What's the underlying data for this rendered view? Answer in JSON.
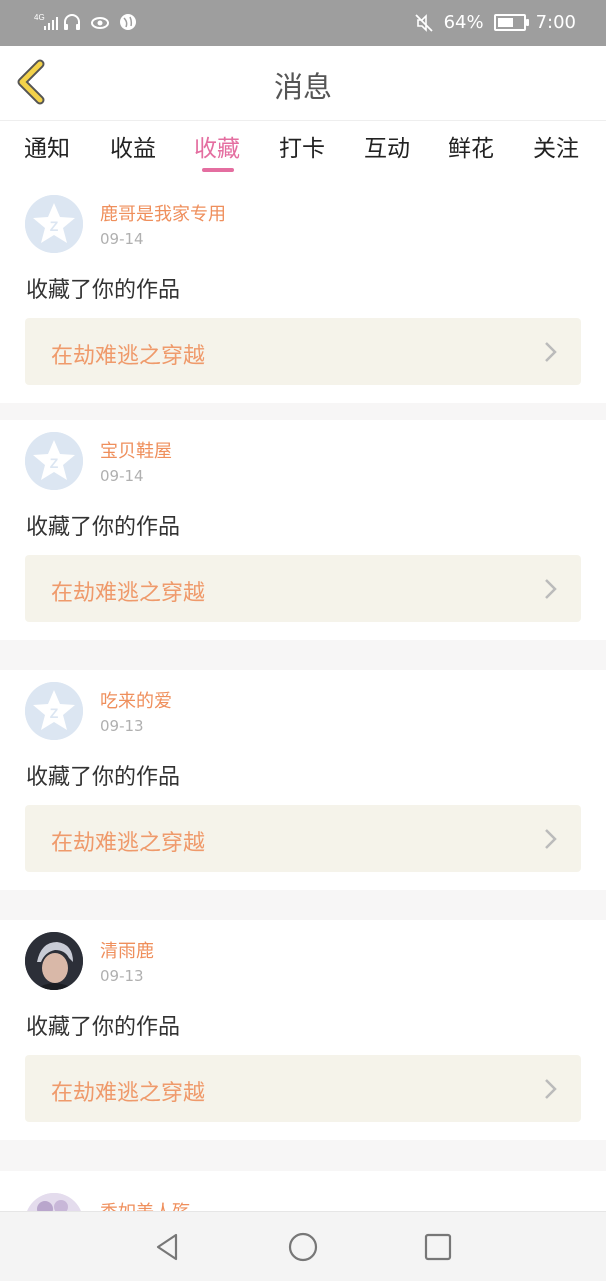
{
  "status_bar": {
    "network": "4G",
    "battery": "64%",
    "time": "7:00",
    "icons": [
      "signal-icon",
      "headset-icon",
      "eye-icon",
      "globe-icon",
      "mute-icon",
      "battery-icon"
    ]
  },
  "header": {
    "title": "消息",
    "back_icon": "back-chevron-icon"
  },
  "tabs": [
    {
      "label": "通知"
    },
    {
      "label": "收益"
    },
    {
      "label": "收藏"
    },
    {
      "label": "打卡"
    },
    {
      "label": "互动"
    },
    {
      "label": "鲜花"
    },
    {
      "label": "关注"
    }
  ],
  "active_tab": "收藏",
  "items": [
    {
      "user": "鹿哥是我家专用",
      "date": "09-14",
      "action": "收藏了你的作品",
      "work": "在劫难逃之穿越",
      "avatar": "default-avatar-icon"
    },
    {
      "user": "宝贝鞋屋",
      "date": "09-14",
      "action": "收藏了你的作品",
      "work": "在劫难逃之穿越",
      "avatar": "default-avatar-icon"
    },
    {
      "user": "吃来的爱",
      "date": "09-13",
      "action": "收藏了你的作品",
      "work": "在劫难逃之穿越",
      "avatar": "default-avatar-icon"
    },
    {
      "user": "清雨鹿",
      "date": "09-13",
      "action": "收藏了你的作品",
      "work": "在劫难逃之穿越",
      "avatar": "photo-avatar"
    },
    {
      "user": "秀如美人殇",
      "avatar": "photo-avatar"
    }
  ],
  "colors": {
    "accent": "#e46ea0",
    "username": "#ef8f5c",
    "work_title": "#ef9a6b",
    "work_bg": "#f5f3ea",
    "status_bar": "#9e9e9e"
  },
  "nav": [
    "back-triangle-icon",
    "home-circle-icon",
    "recents-square-icon"
  ]
}
